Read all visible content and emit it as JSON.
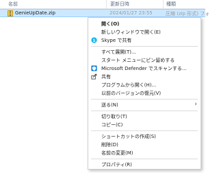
{
  "columns": {
    "name": "名前",
    "modified": "更新日時",
    "type": "種類"
  },
  "file": {
    "name": "GenieUpDate.zip",
    "modified": "2024/01/27 23:55",
    "type": "圧縮 (zip 形式) フォ"
  },
  "menu": {
    "open": "開く(O)",
    "open_new_window": "新しいウィンドウで開く(E)",
    "skype_share": "Skype で共有",
    "extract_all": "すべて展開(T)...",
    "pin_start": "スタート メニューにピン留めする",
    "defender_scan": "Microsoft Defender でスキャンする...",
    "share": "共有",
    "open_with": "プログラムから開く(H)...",
    "restore_previous": "以前のバージョンの復元(V)",
    "send_to": "送る(N)",
    "cut": "切り取り(T)",
    "copy": "コピー(C)",
    "create_shortcut": "ショートカットの作成(S)",
    "delete": "削除(D)",
    "rename": "名前の変更(M)",
    "properties": "プロパティ(R)",
    "submenu_chevron": "›"
  },
  "colors": {
    "selection": "#cce8ff",
    "skype": "#00aff0",
    "defender": "#0078d4"
  },
  "icons": {
    "file": "zip-folder-icon",
    "skype": "skype-icon",
    "defender": "defender-shield-icon",
    "share": "share-icon"
  }
}
